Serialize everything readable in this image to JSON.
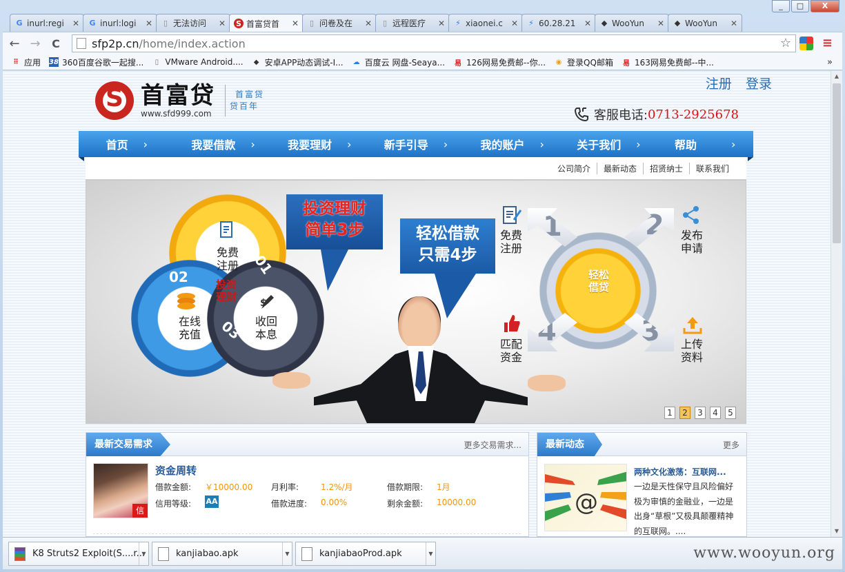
{
  "window": {
    "min": "_",
    "restore": "□",
    "close": "X"
  },
  "tabs": [
    {
      "icon": "G",
      "icon_color": "#4285f4",
      "title": "inurl:regi"
    },
    {
      "icon": "G",
      "icon_color": "#4285f4",
      "title": "inurl:logi"
    },
    {
      "icon": "▯",
      "icon_color": "#888888",
      "title": "无法访问"
    },
    {
      "icon": "S",
      "icon_color": "#c9261f",
      "title": "首富贷首"
    },
    {
      "icon": "▯",
      "icon_color": "#888888",
      "title": "问卷及在"
    },
    {
      "icon": "▯",
      "icon_color": "#888888",
      "title": "远程医疗"
    },
    {
      "icon": "⚡",
      "icon_color": "#3a7bd5",
      "title": "xiaonei.c"
    },
    {
      "icon": "⚡",
      "icon_color": "#3a7bd5",
      "title": "60.28.21"
    },
    {
      "icon": "◆",
      "icon_color": "#333333",
      "title": "WooYun"
    },
    {
      "icon": "◆",
      "icon_color": "#333333",
      "title": "WooYun"
    }
  ],
  "toolbar": {
    "back": "←",
    "forward": "→",
    "reload": "C",
    "url_domain": "sfp2p.cn",
    "url_path": "/home/index.action",
    "star": "☆",
    "menu": "≡"
  },
  "bookmarks": {
    "items": [
      {
        "icon": "⠿",
        "label": "应用"
      },
      {
        "icon": "38",
        "label": "360百度谷歌一起搜..."
      },
      {
        "icon": "▯",
        "label": "VMware Android...."
      },
      {
        "icon": "◆",
        "label": "安卓APP动态调试-I..."
      },
      {
        "icon": "☁",
        "label": "百度云 网盘-Seaya..."
      },
      {
        "icon": "易",
        "label": "126网易免费邮--你..."
      },
      {
        "icon": "◉",
        "label": "登录QQ邮箱"
      },
      {
        "icon": "易",
        "label": "163网易免费邮--中..."
      }
    ],
    "more": "»"
  },
  "site": {
    "logo_cn": "首富贷",
    "logo_url": "www.sfd999.com",
    "slogan_1": "首富贷",
    "slogan_2": "贷百年",
    "register": "注册",
    "login": "登录",
    "hotline_label": "客服电话:",
    "hotline_number": "0713-2925678"
  },
  "nav": [
    {
      "label": "首页",
      "chev": "›"
    },
    {
      "label": "我要借款",
      "chev": "›"
    },
    {
      "label": "我要理财",
      "chev": "›"
    },
    {
      "label": "新手引导",
      "chev": "›"
    },
    {
      "label": "我的账户",
      "chev": "›"
    },
    {
      "label": "关于我们",
      "chev": "›"
    },
    {
      "label": "帮助",
      "chev": "›"
    }
  ],
  "subnav": [
    "公司简介",
    "最新动态",
    "招贤纳士",
    "联系我们"
  ],
  "banner": {
    "invest_title_1": "投资理财",
    "invest_title_2": "简单3步",
    "loan_title_1": "轻松借款",
    "loan_title_2": "只需4步",
    "invest_center_1": "投资",
    "invest_center_2": "理财",
    "invest_steps": [
      {
        "num": "01",
        "label_1": "免费",
        "label_2": "注册"
      },
      {
        "num": "02",
        "label_1": "在线",
        "label_2": "充值"
      },
      {
        "num": "03",
        "label_1": "收回",
        "label_2": "本息"
      }
    ],
    "loan_center_1": "轻松",
    "loan_center_2": "借贷",
    "loan_steps": [
      {
        "num": "1",
        "label_1": "免费",
        "label_2": "注册"
      },
      {
        "num": "2",
        "label_1": "发布",
        "label_2": "申请"
      },
      {
        "num": "3",
        "label_1": "上传",
        "label_2": "资料"
      },
      {
        "num": "4",
        "label_1": "匹配",
        "label_2": "资金"
      }
    ],
    "pages": [
      "1",
      "2",
      "3",
      "4",
      "5"
    ],
    "active_page": "2"
  },
  "trade": {
    "title": "最新交易需求",
    "more": "更多交易需求...",
    "loan": {
      "title": "资金周转",
      "badge": "信",
      "amount_label": "借款金额:",
      "amount": "￥10000.00",
      "rate_label": "月利率:",
      "rate": "1.2%/月",
      "term_label": "借款期限:",
      "term": "1月",
      "grade_label": "信用等级:",
      "grade": "AA",
      "progress_label": "借款进度:",
      "progress": "0.00%",
      "remain_label": "剩余金额:",
      "remain": "10000.00"
    }
  },
  "news": {
    "title": "最新动态",
    "more": "更多",
    "item_title": "两种文化激荡：互联网...",
    "item_body": "一边是天性保守且风险偏好极为审慎的金融业，一边是出身“草根”又极具颠覆精神的互联网。...."
  },
  "downloads": [
    {
      "name": "K8 Struts2 Exploit(S....r..."
    },
    {
      "name": "kanjiabao.apk"
    },
    {
      "name": "kanjiabaoProd.apk"
    }
  ],
  "watermark": "www.wooyun.org"
}
